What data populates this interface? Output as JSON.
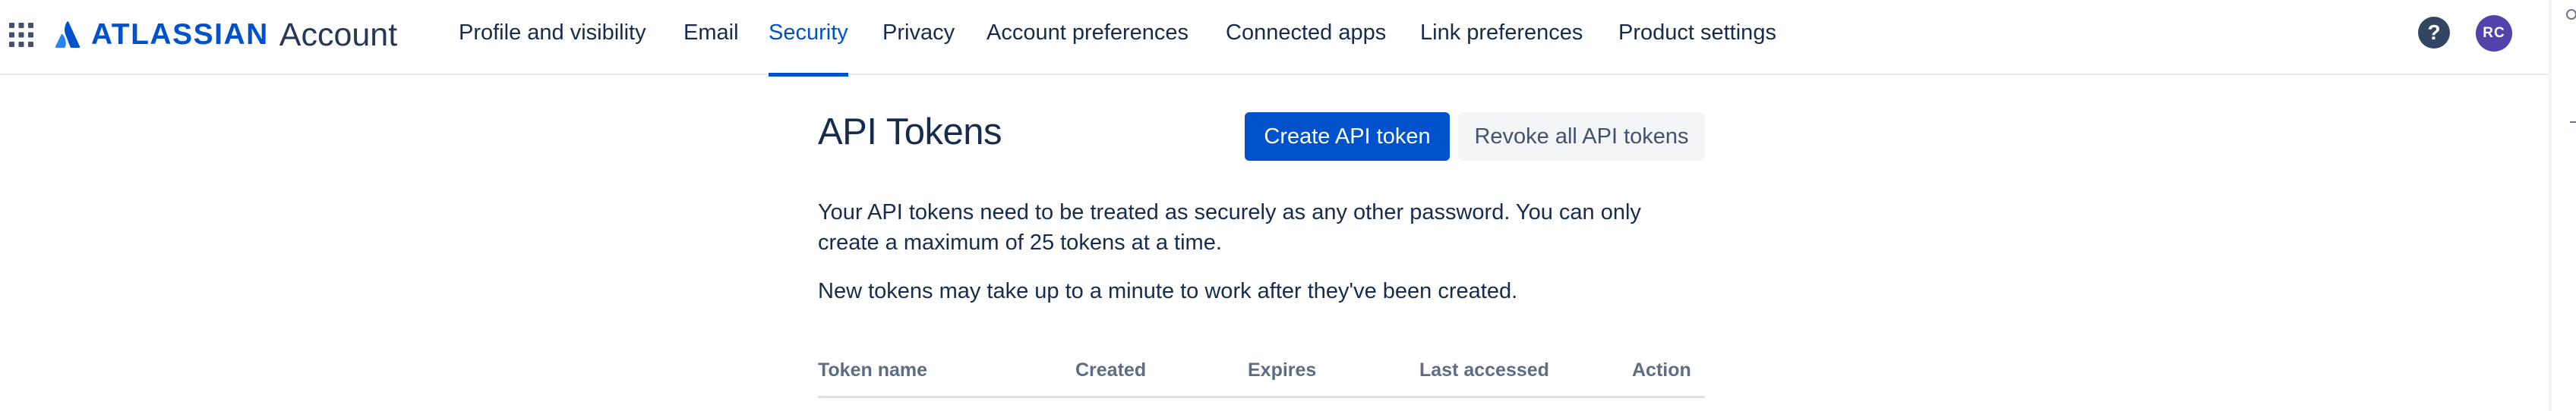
{
  "header": {
    "logo_brand": "ATLASSIAN",
    "logo_product": "Account",
    "nav": [
      {
        "label": "Profile and visibility"
      },
      {
        "label": "Email"
      },
      {
        "label": "Security",
        "active": true
      },
      {
        "label": "Privacy"
      },
      {
        "label": "Account preferences"
      },
      {
        "label": "Connected apps"
      },
      {
        "label": "Link preferences"
      },
      {
        "label": "Product settings"
      }
    ],
    "help_icon": "?",
    "avatar_initials": "RC"
  },
  "main": {
    "title": "API Tokens",
    "create_button": "Create API token",
    "revoke_button": "Revoke all API tokens",
    "description": "Your API tokens need to be treated as securely as any other password. You can only create a maximum of 25 tokens at a time.",
    "note": "New tokens may take up to a minute to work after they've been created.",
    "table": {
      "columns": [
        "Token name",
        "Created",
        "Expires",
        "Last accessed",
        "Action"
      ]
    }
  },
  "colors": {
    "brand": "#0052cc",
    "text": "#172b4d",
    "muted": "#5e6c84",
    "avatar": "#5243aa"
  }
}
